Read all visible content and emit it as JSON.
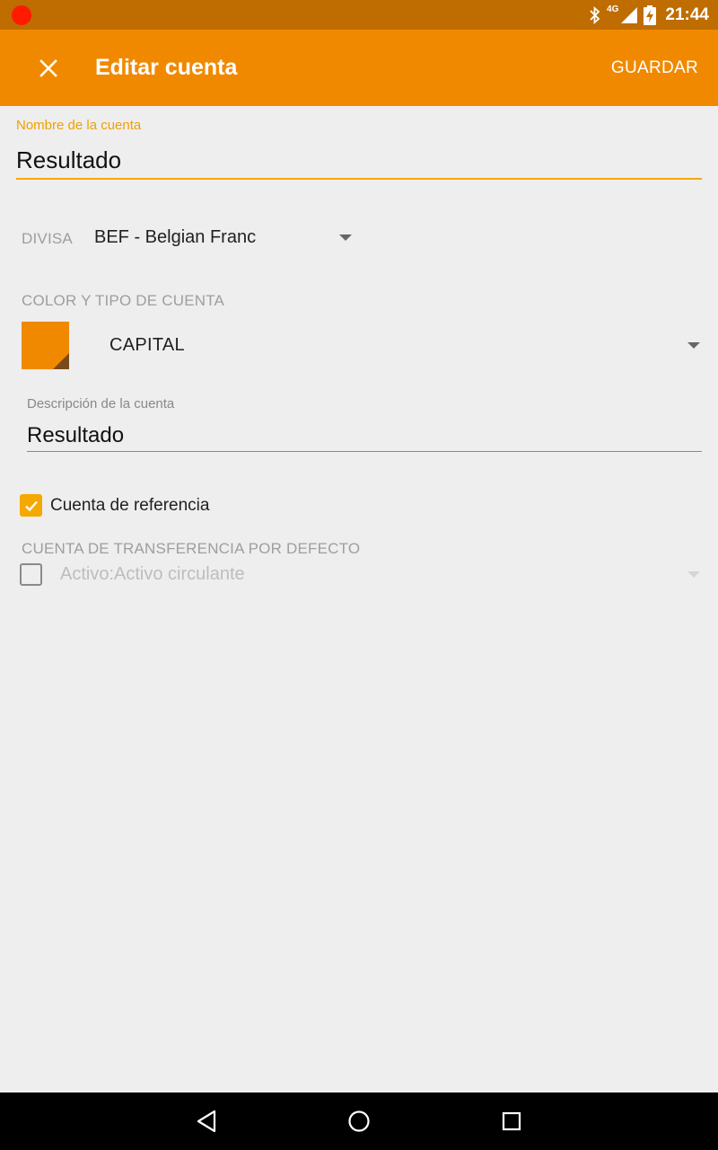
{
  "status_bar": {
    "network_label": "4G",
    "time": "21:44"
  },
  "toolbar": {
    "title": "Editar cuenta",
    "save_label": "GUARDAR"
  },
  "form": {
    "account_name": {
      "label": "Nombre de la cuenta",
      "value": "Resultado"
    },
    "currency": {
      "label": "DIVISA",
      "value": "BEF - Belgian Franc"
    },
    "color_type": {
      "label": "COLOR Y TIPO DE CUENTA",
      "swatch_color": "#f08900",
      "type_value": "CAPITAL"
    },
    "description": {
      "label": "Descripción de la cuenta",
      "value": "Resultado"
    },
    "placeholder_account": {
      "label": "Cuenta de referencia",
      "checked": true
    },
    "default_transfer": {
      "label": "CUENTA DE TRANSFERENCIA POR DEFECTO",
      "checked": false,
      "value": "Activo:Activo circulante"
    }
  },
  "colors": {
    "primary": "#f08900",
    "primary_dark": "#bf6c00",
    "accent": "#f5a800",
    "background": "#eeeeee"
  },
  "icons": [
    "record-dot-icon",
    "bluetooth-icon",
    "signal-icon",
    "battery-charging-icon",
    "close-icon",
    "chevron-down-icon",
    "checkmark-icon",
    "back-nav-icon",
    "home-nav-icon",
    "recents-nav-icon"
  ]
}
